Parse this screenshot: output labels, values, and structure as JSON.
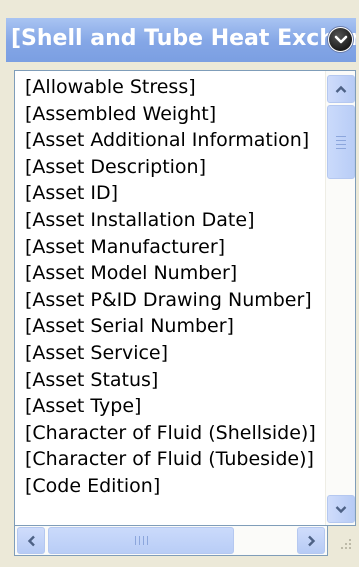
{
  "header": {
    "title": "[Shell and Tube Heat Exchanger]",
    "dropdown_icon": "chevron-down-circle-icon"
  },
  "list": {
    "items": [
      "[Allowable Stress]",
      "[Assembled Weight]",
      "[Asset Additional Information]",
      "[Asset Description]",
      "[Asset ID]",
      "[Asset Installation Date]",
      "[Asset Manufacturer]",
      "[Asset Model Number]",
      "[Asset P&ID Drawing Number]",
      "[Asset Serial Number]",
      "[Asset Service]",
      "[Asset Status]",
      "[Asset Type]",
      "[Character of Fluid (Shellside)]",
      "[Character of Fluid (Tubeside)]",
      "[Code Edition]"
    ]
  },
  "scrollbars": {
    "vertical": {
      "up_icon": "chevron-up-icon",
      "down_icon": "chevron-down-icon"
    },
    "horizontal": {
      "left_icon": "chevron-left-icon",
      "right_icon": "chevron-right-icon"
    }
  },
  "colors": {
    "title_bar": "#84a6e6",
    "scroll_accent": "#b9cdf6",
    "arrow": "#4d6185"
  }
}
